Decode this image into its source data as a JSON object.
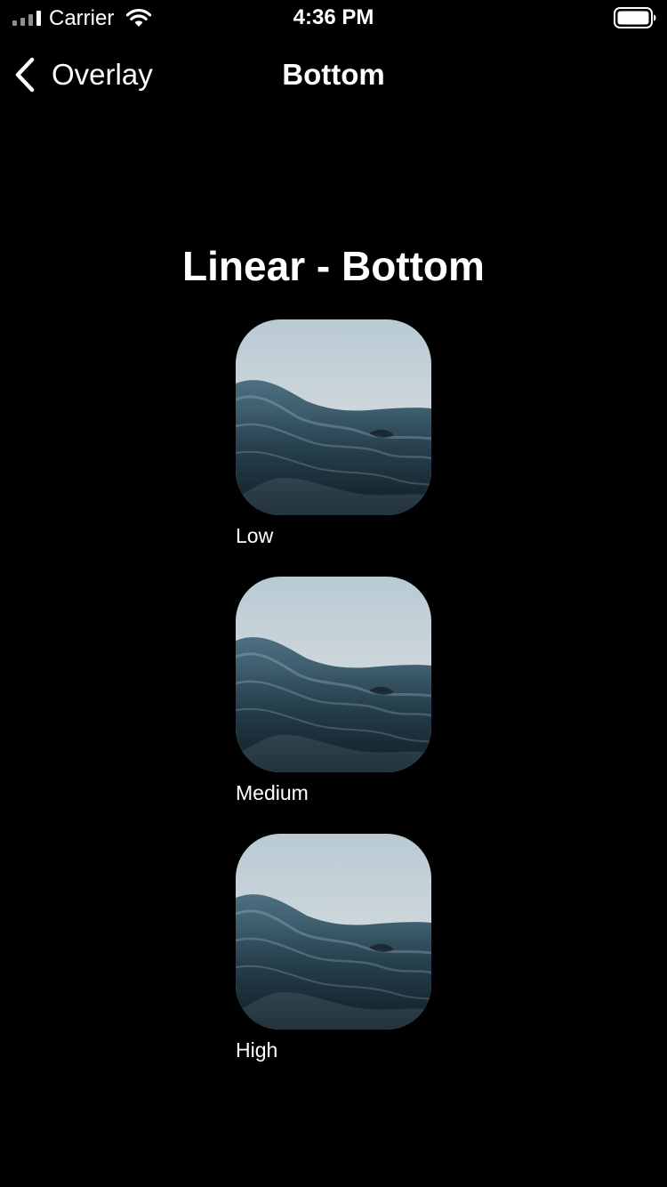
{
  "status_bar": {
    "carrier": "Carrier",
    "time": "4:36 PM",
    "icons": [
      "signal-icon",
      "wifi-icon",
      "battery-icon"
    ]
  },
  "nav": {
    "back_label": "Overlay",
    "title": "Bottom",
    "back_icon": "chevron-left-icon"
  },
  "content": {
    "section_title": "Linear - Bottom",
    "items": [
      {
        "label": "Low"
      },
      {
        "label": "Medium"
      },
      {
        "label": "High"
      }
    ]
  },
  "colors": {
    "background": "#000000",
    "text": "#ffffff"
  }
}
